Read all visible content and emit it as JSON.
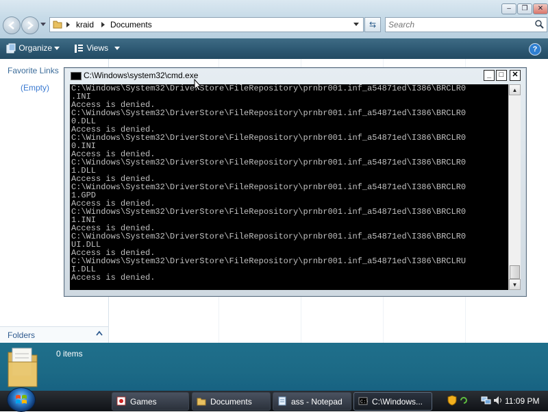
{
  "explorer": {
    "address": {
      "segments": [
        "kraid",
        "Documents"
      ]
    },
    "search": {
      "placeholder": "Search"
    },
    "toolbar": {
      "organize": "Organize",
      "views": "Views",
      "help": "?"
    },
    "left_pane": {
      "favorite_links": "Favorite Links",
      "empty": "(Empty)",
      "folders": "Folders"
    },
    "details": {
      "count": "0 items"
    }
  },
  "cmd": {
    "title": "C:\\Windows\\system32\\cmd.exe",
    "lines": [
      "C:\\Windows\\System32\\DriverStore\\FileRepository\\prnbr001.inf_a54871ed\\I386\\BRCLR0",
      ".INI",
      "Access is denied.",
      "C:\\Windows\\System32\\DriverStore\\FileRepository\\prnbr001.inf_a54871ed\\I386\\BRCLR0",
      "0.DLL",
      "Access is denied.",
      "C:\\Windows\\System32\\DriverStore\\FileRepository\\prnbr001.inf_a54871ed\\I386\\BRCLR0",
      "0.INI",
      "Access is denied.",
      "C:\\Windows\\System32\\DriverStore\\FileRepository\\prnbr001.inf_a54871ed\\I386\\BRCLR0",
      "1.DLL",
      "Access is denied.",
      "C:\\Windows\\System32\\DriverStore\\FileRepository\\prnbr001.inf_a54871ed\\I386\\BRCLR0",
      "1.GPD",
      "Access is denied.",
      "C:\\Windows\\System32\\DriverStore\\FileRepository\\prnbr001.inf_a54871ed\\I386\\BRCLR0",
      "1.INI",
      "Access is denied.",
      "C:\\Windows\\System32\\DriverStore\\FileRepository\\prnbr001.inf_a54871ed\\I386\\BRCLR0",
      "UI.DLL",
      "Access is denied.",
      "C:\\Windows\\System32\\DriverStore\\FileRepository\\prnbr001.inf_a54871ed\\I386\\BRCLRU",
      "I.DLL",
      "Access is denied."
    ]
  },
  "taskbar": {
    "tasks": [
      "Games",
      "Documents",
      "ass - Notepad",
      "C:\\Windows..."
    ],
    "clock": "11:09 PM"
  },
  "colors": {
    "toolbar": "#2e5a74",
    "details": "#1c6a86",
    "taskbar": "#1a1e24"
  }
}
